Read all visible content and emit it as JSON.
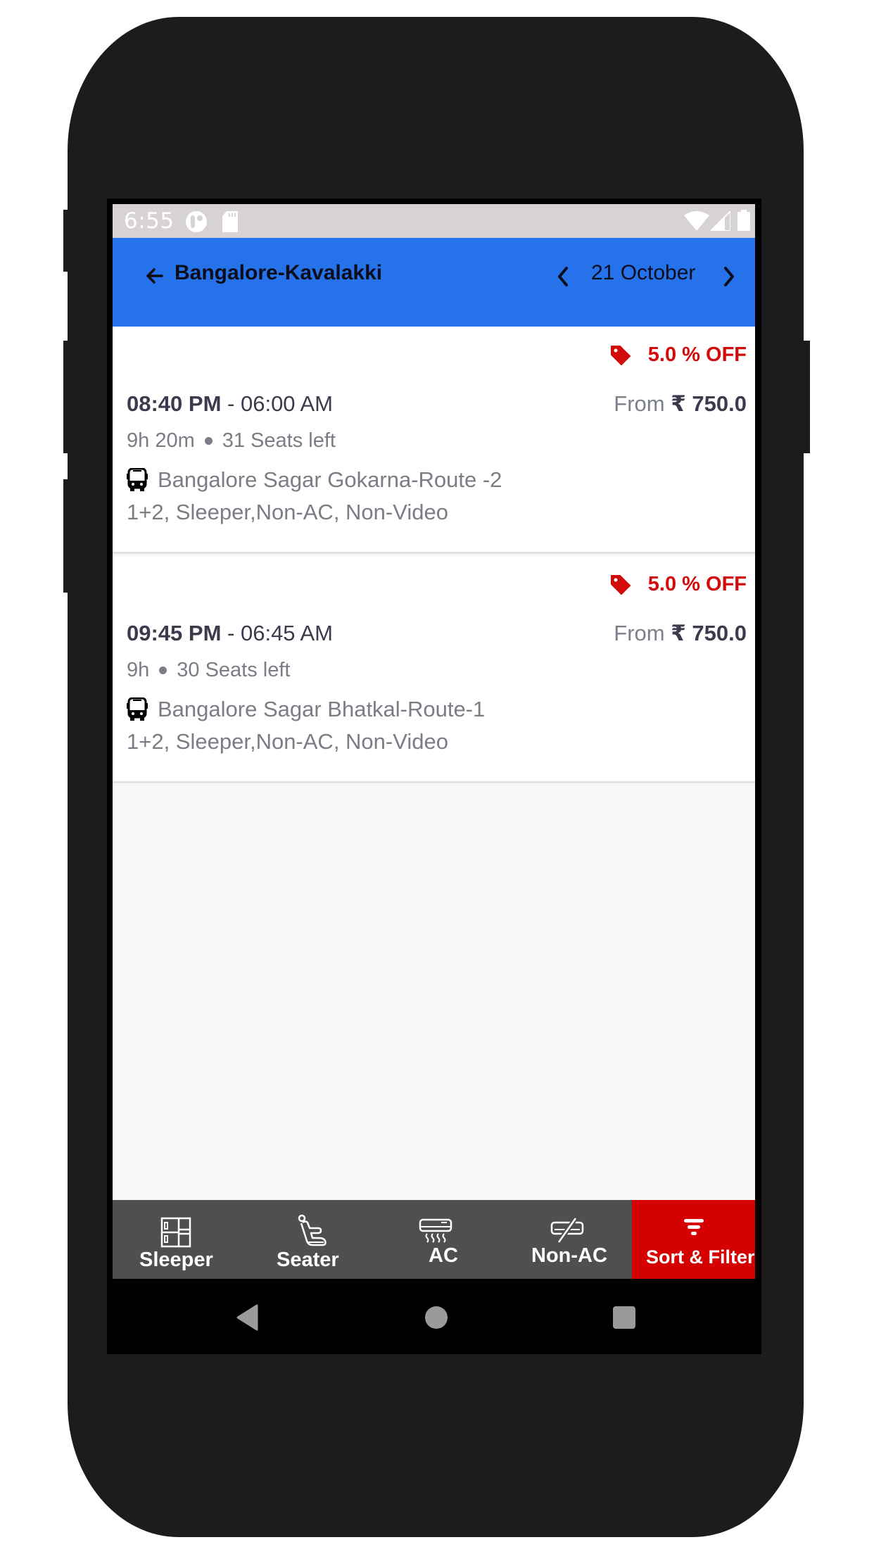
{
  "status_bar": {
    "time": "6:55",
    "left_icons": [
      "notification-app-icon",
      "sd-card-icon"
    ],
    "right_icons": [
      "wifi-icon",
      "signal-icon",
      "battery-icon"
    ]
  },
  "app_bar": {
    "back_icon": "arrow-left-icon",
    "title": "Bangalore-Kavalakki",
    "date_prev_icon": "chevron-left-icon",
    "date": "21 October",
    "date_next_icon": "chevron-right-icon"
  },
  "buses": [
    {
      "discount": "5.0 % OFF",
      "departure": "08:40 PM",
      "separator": " - ",
      "arrival": "06:00 AM",
      "price_prefix": "From",
      "price": "₹ 750.0",
      "duration": "9h 20m",
      "seats": "31 Seats left",
      "route": "Bangalore Sagar Gokarna-Route -2",
      "amenities": "1+2, Sleeper,Non-AC, Non-Video"
    },
    {
      "discount": "5.0 % OFF",
      "departure": "09:45 PM",
      "separator": " - ",
      "arrival": "06:45 AM",
      "price_prefix": "From",
      "price": "₹ 750.0",
      "duration": "9h",
      "seats": "30 Seats left",
      "route": "Bangalore Sagar Bhatkal-Route-1",
      "amenities": "1+2, Sleeper,Non-AC, Non-Video"
    }
  ],
  "filter_bar": {
    "items": [
      {
        "label": "Sleeper",
        "icon": "sleeper-icon"
      },
      {
        "label": "Seater",
        "icon": "seat-icon"
      },
      {
        "label": "AC",
        "icon": "air-conditioner-icon"
      },
      {
        "label": "Non-AC",
        "icon": "no-ac-icon"
      },
      {
        "label": "Sort & Filter",
        "icon": "filter-icon"
      }
    ]
  },
  "colors": {
    "app_bar": "#2672ea",
    "discount": "#d20a0a",
    "sort_filter": "#d50000",
    "filter_bar": "#4f4f4f"
  }
}
